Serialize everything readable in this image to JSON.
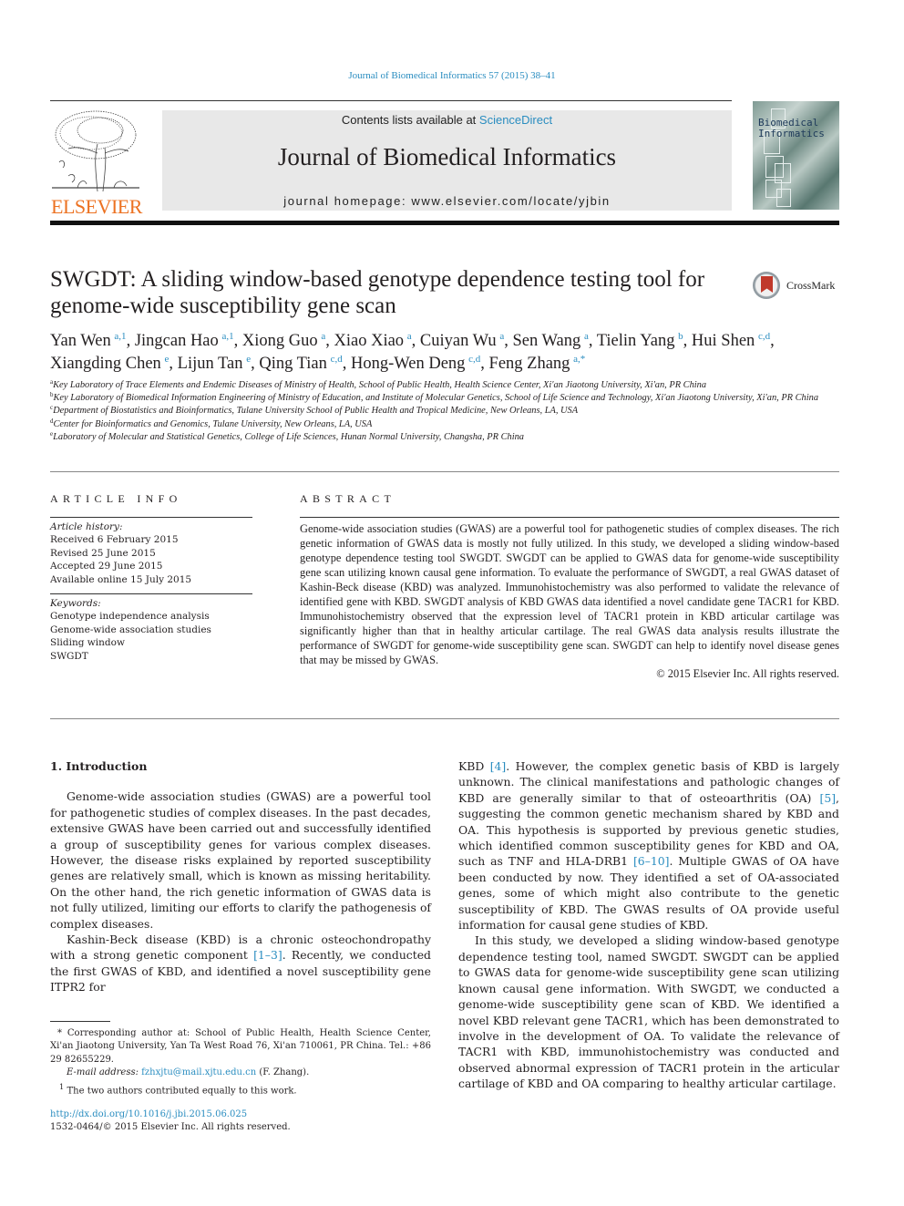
{
  "header": {
    "journal_ref": "Journal of Biomedical Informatics 57 (2015) 38–41",
    "contents_prefix": "Contents lists available at ",
    "contents_link": "ScienceDirect",
    "journal_title": "Journal of Biomedical Informatics",
    "homepage": "journal homepage: www.elsevier.com/locate/yjbin",
    "publisher_logo": "ELSEVIER",
    "cover_title_line1": "Biomedical",
    "cover_title_line2": "Informatics",
    "brand_orange": "#ec7222",
    "link_blue": "#2a8dc0"
  },
  "article": {
    "title": "SWGDT: A sliding window-based genotype dependence testing tool for genome-wide susceptibility gene scan",
    "crossmark_label": "CrossMark",
    "authors": [
      {
        "name": "Yan Wen",
        "sup": "a,1"
      },
      {
        "name": "Jingcan Hao",
        "sup": "a,1"
      },
      {
        "name": "Xiong Guo",
        "sup": "a"
      },
      {
        "name": "Xiao Xiao",
        "sup": "a"
      },
      {
        "name": "Cuiyan Wu",
        "sup": "a"
      },
      {
        "name": "Sen Wang",
        "sup": "a"
      },
      {
        "name": "Tielin Yang",
        "sup": "b"
      },
      {
        "name": "Hui Shen",
        "sup": "c,d"
      },
      {
        "name": "Xiangding Chen",
        "sup": "e"
      },
      {
        "name": "Lijun Tan",
        "sup": "e"
      },
      {
        "name": "Qing Tian",
        "sup": "c,d"
      },
      {
        "name": "Hong-Wen Deng",
        "sup": "c,d"
      },
      {
        "name": "Feng Zhang",
        "sup": "a,*"
      }
    ],
    "affiliations": [
      {
        "key": "a",
        "text": "Key Laboratory of Trace Elements and Endemic Diseases of Ministry of Health, School of Public Health, Health Science Center, Xi'an Jiaotong University, Xi'an, PR China"
      },
      {
        "key": "b",
        "text": "Key Laboratory of Biomedical Information Engineering of Ministry of Education, and Institute of Molecular Genetics, School of Life Science and Technology, Xi'an Jiaotong University, Xi'an, PR China"
      },
      {
        "key": "c",
        "text": "Department of Biostatistics and Bioinformatics, Tulane University School of Public Health and Tropical Medicine, New Orleans, LA, USA"
      },
      {
        "key": "d",
        "text": "Center for Bioinformatics and Genomics, Tulane University, New Orleans, LA, USA"
      },
      {
        "key": "e",
        "text": "Laboratory of Molecular and Statistical Genetics, College of Life Sciences, Hunan Normal University, Changsha, PR China"
      }
    ]
  },
  "article_info": {
    "heading": "ARTICLE INFO",
    "history_label": "Article history:",
    "history": [
      "Received 6 February 2015",
      "Revised 25 June 2015",
      "Accepted 29 June 2015",
      "Available online 15 July 2015"
    ],
    "keywords_label": "Keywords:",
    "keywords": [
      "Genotype independence analysis",
      "Genome-wide association studies",
      "Sliding window",
      "SWGDT"
    ]
  },
  "abstract": {
    "heading": "ABSTRACT",
    "text": "Genome-wide association studies (GWAS) are a powerful tool for pathogenetic studies of complex diseases. The rich genetic information of GWAS data is mostly not fully utilized. In this study, we developed a sliding window-based genotype dependence testing tool SWGDT. SWGDT can be applied to GWAS data for genome-wide susceptibility gene scan utilizing known causal gene information. To evaluate the performance of SWGDT, a real GWAS dataset of Kashin-Beck disease (KBD) was analyzed. Immunohistochemistry was also performed to validate the relevance of identified gene with KBD. SWGDT analysis of KBD GWAS data identified a novel candidate gene TACR1 for KBD. Immunohistochemistry observed that the expression level of TACR1 protein in KBD articular cartilage was significantly higher than that in healthy articular cartilage. The real GWAS data analysis results illustrate the performance of SWGDT for genome-wide susceptibility gene scan. SWGDT can help to identify novel disease genes that may be missed by GWAS.",
    "copyright": "© 2015 Elsevier Inc. All rights reserved."
  },
  "intro": {
    "heading": "1. Introduction",
    "p1": "Genome-wide association studies (GWAS) are a powerful tool for pathogenetic studies of complex diseases. In the past decades, extensive GWAS have been carried out and successfully identified a group of susceptibility genes for various complex diseases. However, the disease risks explained by reported susceptibility genes are relatively small, which is known as missing heritability. On the other hand, the rich genetic information of GWAS data is not fully utilized, limiting our efforts to clarify the pathogenesis of complex diseases.",
    "p2_a": "Kashin-Beck disease (KBD) is a chronic osteochondropathy with a strong genetic component ",
    "p2_ref1": "[1–3]",
    "p2_b": ". Recently, we conducted the first GWAS of KBD, and identified a novel susceptibility gene ITPR2 for",
    "p3_a": "KBD ",
    "p3_ref1": "[4]",
    "p3_b": ". However, the complex genetic basis of KBD is largely unknown. The clinical manifestations and pathologic changes of KBD are generally similar to that of osteoarthritis (OA) ",
    "p3_ref2": "[5]",
    "p3_c": ", suggesting the common genetic mechanism shared by KBD and OA. This hypothesis is supported by previous genetic studies, which identified common susceptibility genes for KBD and OA, such as TNF and HLA-DRB1 ",
    "p3_ref3": "[6–10]",
    "p3_d": ". Multiple GWAS of OA have been conducted by now. They identified a set of OA-associated genes, some of which might also contribute to the genetic susceptibility of KBD. The GWAS results of OA provide useful information for causal gene studies of KBD.",
    "p4": "In this study, we developed a sliding window-based genotype dependence testing tool, named SWGDT. SWGDT can be applied to GWAS data for genome-wide susceptibility gene scan utilizing known causal gene information. With SWGDT, we conducted a genome-wide susceptibility gene scan of KBD. We identified a novel KBD relevant gene TACR1, which has been demonstrated to involve in the development of OA. To validate the relevance of TACR1 with KBD, immunohistochemistry was conducted and observed abnormal expression of TACR1 protein in the articular cartilage of KBD and OA comparing to healthy articular cartilage."
  },
  "footnotes": {
    "corresponding": "* Corresponding author at: School of Public Health, Health Science Center, Xi'an Jiaotong University, Yan Ta West Road 76, Xi'an 710061, PR China. Tel.: +86 29 82655229.",
    "email_label": "E-mail address: ",
    "email": "fzhxjtu@mail.xjtu.edu.cn",
    "email_suffix": " (F. Zhang).",
    "fn1_mark": "1",
    "fn1": "The two authors contributed equally to this work.",
    "doi": "http://dx.doi.org/10.1016/j.jbi.2015.06.025",
    "issn": "1532-0464/© 2015 Elsevier Inc. All rights reserved."
  }
}
